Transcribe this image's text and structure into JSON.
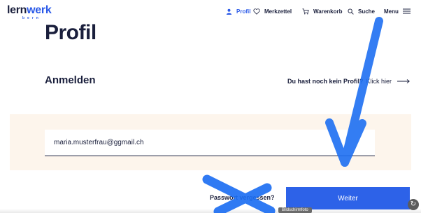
{
  "header": {
    "logo_main": "lern",
    "logo_accent": "werk",
    "logo_sub": "bern",
    "nav": {
      "profil": "Profil",
      "merkzettel": "Merkzettel",
      "warenkorb": "Warenkorb",
      "suche": "Suche",
      "menu": "Menu"
    }
  },
  "page": {
    "title": "Profil",
    "section_title": "Anmelden",
    "register_question": "Du hast noch kein Profil?",
    "register_link": "Klick hier"
  },
  "form": {
    "email_value": "maria.musterfrau@ggmail.ch",
    "forgot_password": "Passwort vergessen?",
    "submit_label": "Weiter"
  },
  "overlay": {
    "tooltip": "Bildschirmfoto"
  },
  "colors": {
    "brand_blue": "#2d62e8",
    "text_navy": "#1a1f3c",
    "band_bg": "#fdf5ec",
    "annotation_blue": "#1e6ff2"
  },
  "icons": [
    "user-icon",
    "heart-icon",
    "cart-icon",
    "search-icon",
    "hamburger-menu-icon",
    "arrow-right-icon"
  ]
}
